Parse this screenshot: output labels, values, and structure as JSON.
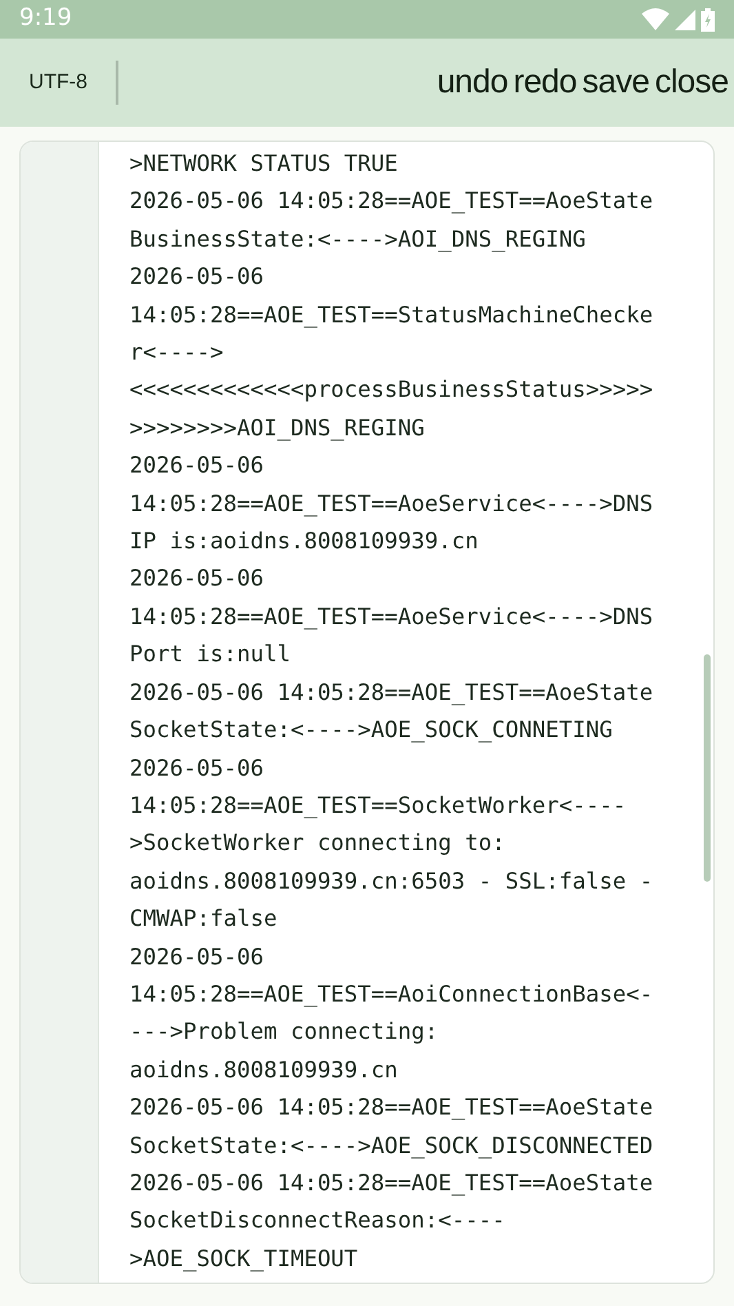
{
  "status_bar": {
    "time": "9:19"
  },
  "toolbar": {
    "encoding": "UTF-8",
    "actions": [
      "undo",
      "redo",
      "save",
      "close"
    ]
  },
  "log": {
    "lines": [
      ">NETWORK STATUS TRUE",
      "2026-05-06 14:05:28==AOE_TEST==AoeState",
      "BusinessState:<---->AOI_DNS_REGING",
      "2026-05-06",
      "14:05:28==AOE_TEST==StatusMachineChecke",
      "r<---->",
      "<<<<<<<<<<<<<processBusinessStatus>>>>>",
      ">>>>>>>>AOI_DNS_REGING",
      "2026-05-06",
      "14:05:28==AOE_TEST==AoeService<---->DNS",
      "IP is:aoidns.8008109939.cn",
      "2026-05-06",
      "14:05:28==AOE_TEST==AoeService<---->DNS",
      "Port is:null",
      "2026-05-06 14:05:28==AOE_TEST==AoeState",
      "SocketState:<---->AOE_SOCK_CONNETING",
      "2026-05-06",
      "14:05:28==AOE_TEST==SocketWorker<----",
      ">SocketWorker connecting to:",
      "aoidns.8008109939.cn:6503 - SSL:false -",
      "CMWAP:false",
      "2026-05-06",
      "14:05:28==AOE_TEST==AoiConnectionBase<-",
      "--->Problem connecting:",
      "aoidns.8008109939.cn",
      "2026-05-06 14:05:28==AOE_TEST==AoeState",
      "SocketState:<---->AOE_SOCK_DISCONNECTED",
      "2026-05-06 14:05:28==AOE_TEST==AoeState",
      "SocketDisconnectReason:<----",
      ">AOE_SOCK_TIMEOUT"
    ]
  }
}
